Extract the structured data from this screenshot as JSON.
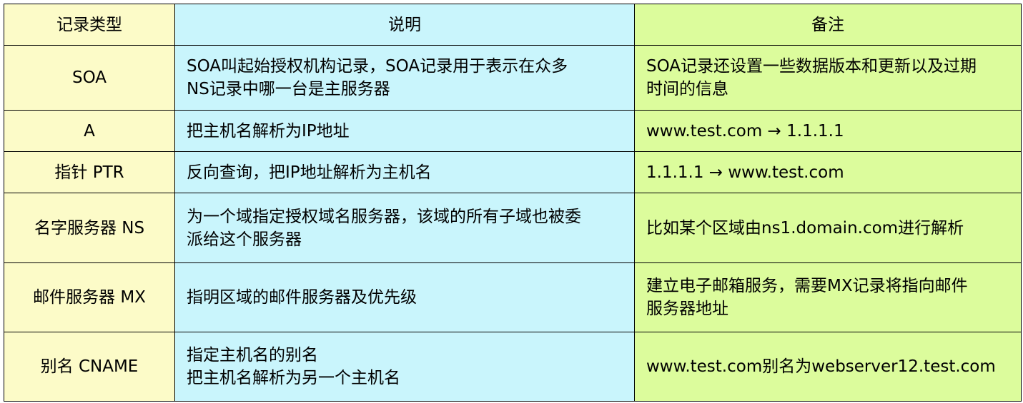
{
  "table": {
    "headers": {
      "type": "记录类型",
      "desc": "说明",
      "note": "备注"
    },
    "rows": [
      {
        "type": "SOA",
        "desc": [
          "SOA叫起始授权机构记录，SOA记录用于表示在众多",
          "NS记录中哪一台是主服务器"
        ],
        "note": [
          "SOA记录还设置一些数据版本和更新以及过期",
          "时间的信息"
        ]
      },
      {
        "type": "A",
        "desc": [
          "把主机名解析为IP地址"
        ],
        "note": [
          "www.test.com → 1.1.1.1"
        ]
      },
      {
        "type": "指针 PTR",
        "desc": [
          "反向查询，把IP地址解析为主机名"
        ],
        "note": [
          "1.1.1.1 → www.test.com"
        ]
      },
      {
        "type": "名字服务器 NS",
        "desc": [
          "为一个域指定授权域名服务器，该域的所有子域也被委",
          "派给这个服务器"
        ],
        "note": [
          "比如某个区域由ns1.domain.com进行解析"
        ]
      },
      {
        "type": "邮件服务器 MX",
        "desc": [
          "指明区域的邮件服务器及优先级"
        ],
        "note": [
          "建立电子邮箱服务，需要MX记录将指向邮件",
          "服务器地址"
        ]
      },
      {
        "type": "别名 CNAME",
        "desc": [
          "指定主机名的别名",
          "把主机名解析为另一个主机名"
        ],
        "note": [
          "www.test.com别名为webserver12.test.com"
        ]
      }
    ]
  },
  "colors": {
    "type_column": "#fcfbc8",
    "desc_column": "#c9f5fc",
    "note_column": "#dcfc9c",
    "border": "#000000"
  }
}
